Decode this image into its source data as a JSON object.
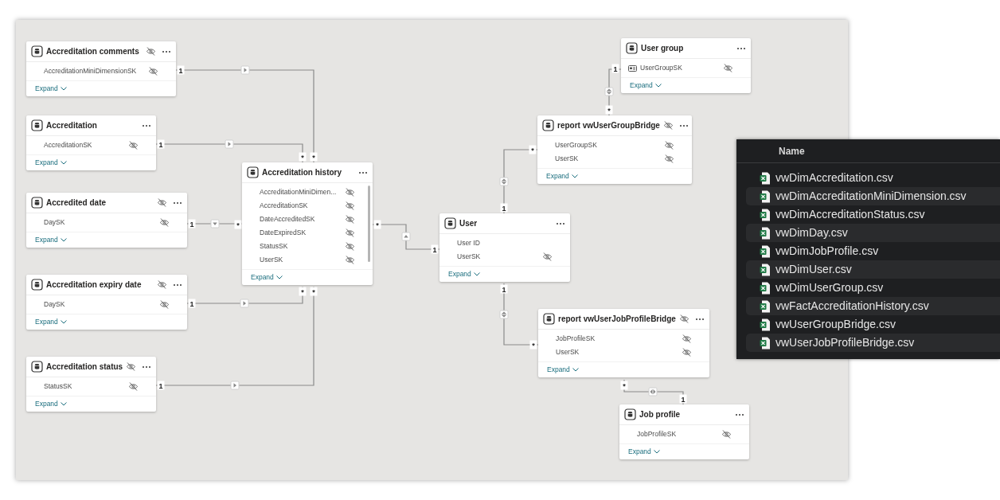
{
  "diagram": {
    "tables": [
      {
        "title": "Accreditation comments",
        "hidden": true,
        "fields": [
          {
            "name": "AccreditationMiniDimensionSK",
            "hidden": true,
            "key": false
          }
        ],
        "expand": "Expand"
      },
      {
        "title": "Accreditation",
        "hidden": false,
        "fields": [
          {
            "name": "AccreditationSK",
            "hidden": true,
            "key": false
          }
        ],
        "expand": "Expand"
      },
      {
        "title": "Accredited date",
        "hidden": true,
        "fields": [
          {
            "name": "DaySK",
            "hidden": true,
            "key": false
          }
        ],
        "expand": "Expand"
      },
      {
        "title": "Accreditation expiry date",
        "hidden": true,
        "fields": [
          {
            "name": "DaySK",
            "hidden": true,
            "key": false
          }
        ],
        "expand": "Expand"
      },
      {
        "title": "Accreditation status",
        "hidden": true,
        "fields": [
          {
            "name": "StatusSK",
            "hidden": true,
            "key": false
          }
        ],
        "expand": "Expand"
      },
      {
        "title": "Accreditation history",
        "hidden": false,
        "fields": [
          {
            "name": "AccreditationMiniDimen...",
            "hidden": true,
            "key": false
          },
          {
            "name": "AccreditationSK",
            "hidden": true,
            "key": false
          },
          {
            "name": "DateAccreditedSK",
            "hidden": true,
            "key": false
          },
          {
            "name": "DateExpiredSK",
            "hidden": true,
            "key": false
          },
          {
            "name": "StatusSK",
            "hidden": true,
            "key": false
          },
          {
            "name": "UserSK",
            "hidden": true,
            "key": false
          }
        ],
        "expand": "Expand"
      },
      {
        "title": "User",
        "hidden": false,
        "fields": [
          {
            "name": "User ID",
            "hidden": false,
            "key": false
          },
          {
            "name": "UserSK",
            "hidden": true,
            "key": false
          }
        ],
        "expand": "Expand"
      },
      {
        "title": "User group",
        "hidden": false,
        "fields": [
          {
            "name": "UserGroupSK",
            "hidden": true,
            "key": true
          }
        ],
        "expand": "Expand"
      },
      {
        "title": "report vwUserGroupBridge",
        "hidden": true,
        "fields": [
          {
            "name": "UserGroupSK",
            "hidden": true,
            "key": false
          },
          {
            "name": "UserSK",
            "hidden": true,
            "key": false
          }
        ],
        "expand": "Expand"
      },
      {
        "title": "report vwUserJobProfileBridge",
        "hidden": true,
        "fields": [
          {
            "name": "JobProfileSK",
            "hidden": true,
            "key": false
          },
          {
            "name": "UserSK",
            "hidden": true,
            "key": false
          }
        ],
        "expand": "Expand"
      },
      {
        "title": "Job profile",
        "hidden": false,
        "fields": [
          {
            "name": "JobProfileSK",
            "hidden": true,
            "key": false
          }
        ],
        "expand": "Expand"
      }
    ],
    "relationships": [
      {
        "one_end": "1",
        "many_end": "*",
        "both_directions": false
      },
      {
        "one_end": "1",
        "many_end": "*",
        "both_directions": false
      },
      {
        "one_end": "1",
        "many_end": "*",
        "both_directions": false
      },
      {
        "one_end": "1",
        "many_end": "*",
        "both_directions": false
      },
      {
        "one_end": "1",
        "many_end": "*",
        "both_directions": false
      },
      {
        "one_end": "1",
        "many_end": "*",
        "both_directions": false
      },
      {
        "one_end": "1",
        "many_end": "*",
        "both_directions": true
      },
      {
        "one_end": "1",
        "many_end": "*",
        "both_directions": true
      },
      {
        "one_end": "1",
        "many_end": "*",
        "both_directions": true
      },
      {
        "one_end": "1",
        "many_end": "*",
        "both_directions": true
      }
    ]
  },
  "file_list": {
    "header": "Name",
    "files": [
      "vwDimAccreditation.csv",
      "vwDimAccreditationMiniDimension.csv",
      "vwDimAccreditationStatus.csv",
      "vwDimDay.csv",
      "vwDimJobProfile.csv",
      "vwDimUser.csv",
      "vwDimUserGroup.csv",
      "vwFactAccreditationHistory.csv",
      "vwUserGroupBridge.csv",
      "vwUserJobProfileBridge.csv"
    ]
  }
}
